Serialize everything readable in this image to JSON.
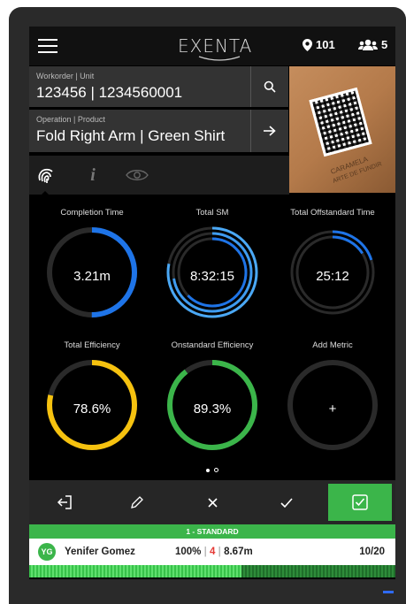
{
  "topbar": {
    "logo": "EXENTA",
    "location_count": "101",
    "user_count": "5"
  },
  "workorder": {
    "label": "Workorder | Unit",
    "value": "123456 | 1234560001"
  },
  "operation": {
    "label": "Operation | Product",
    "value": "Fold Right Arm | Green Shirt"
  },
  "photo": {
    "text_line1": "CARAMELA",
    "text_line2": "ARTE DE FUNDIR"
  },
  "tabs": [
    {
      "icon": "fingerprint-icon",
      "active": true
    },
    {
      "icon": "info-icon",
      "active": false
    },
    {
      "icon": "eye-icon",
      "active": false
    }
  ],
  "metrics": [
    {
      "title": "Completion Time",
      "value": "3.21m",
      "color": "#1e74e8",
      "progress": 0.5
    },
    {
      "title": "Total SM",
      "value": "8:32:15",
      "color": "#3e9bf0"
    },
    {
      "title": "Total Offstandard Time",
      "value": "25:12",
      "color": "#1e74e8",
      "progress": 0.2
    },
    {
      "title": "Total Efficiency",
      "value": "78.6%",
      "color": "#f6c20f",
      "progress": 0.786
    },
    {
      "title": "Onstandard Efficiency",
      "value": "89.3%",
      "color": "#3bb54a",
      "progress": 0.893
    },
    {
      "title": "Add Metric",
      "value": "+",
      "color": "#2a2a2a",
      "progress": 0
    }
  ],
  "pagination": {
    "pages": 2,
    "current": 1
  },
  "actions": {
    "logout": "logout-icon",
    "edit": "pencil-icon",
    "cancel": "close-icon",
    "confirm": "check-icon",
    "submit": "checkbox-icon"
  },
  "standard": {
    "label": "1 - STANDARD"
  },
  "operator": {
    "initials": "YG",
    "name": "Yenifer Gomez",
    "efficiency": "100%",
    "count_red": "4",
    "time": "8.67m",
    "pieces": "10/20"
  },
  "progress": {
    "fraction": 0.58
  },
  "colors": {
    "green": "#3bb54a",
    "blue": "#1e74e8",
    "yellow": "#f6c20f",
    "red": "#e53935"
  }
}
